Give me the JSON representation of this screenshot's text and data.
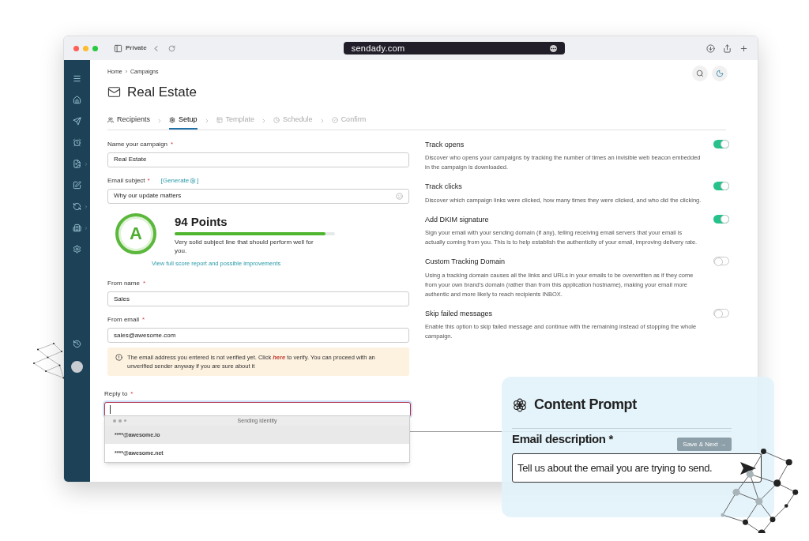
{
  "browser": {
    "private_label": "Private",
    "url": "sendady.com"
  },
  "breadcrumb": [
    "Home",
    "Campaigns"
  ],
  "breadcrumb_separator": "›",
  "title": "Real Estate",
  "steps": [
    {
      "label": "Recipients",
      "selected": false,
      "enabled": true
    },
    {
      "label": "Setup",
      "selected": true,
      "enabled": true
    },
    {
      "label": "Template",
      "selected": false,
      "enabled": false
    },
    {
      "label": "Schedule",
      "selected": false,
      "enabled": false
    },
    {
      "label": "Confirm",
      "selected": false,
      "enabled": false
    }
  ],
  "campaign_name": {
    "label": "Name your campaign",
    "required_mark": "*",
    "value": "Real Estate"
  },
  "subject": {
    "label": "Email subject",
    "required_mark": "*",
    "generate": "[Generate",
    "generate_close": "]",
    "value": "Why our update matters"
  },
  "score": {
    "grade": "A",
    "points": "94 Points",
    "level": 0.94,
    "message": "Very solid subject line that should perform well for you.",
    "report_link": "View full score report and possible improvements"
  },
  "from_name": {
    "label": "From name",
    "required_mark": "*",
    "value": "Sales"
  },
  "from_email": {
    "label": "From email",
    "required_mark": "*",
    "value": "sales@awesome.com"
  },
  "warning": {
    "before": "The email address you entered is not verified yet. Click ",
    "link": "here",
    "after": " to verify. You can proceed with an unverified sender anyway if you are sure about it"
  },
  "reply_to": {
    "label": "Reply to",
    "required_mark": "*",
    "invalid": true,
    "dropdown": {
      "header": "Sending identity",
      "options": [
        {
          "label": "****@awesome.io",
          "selected": true
        },
        {
          "label": "****@awesome.net",
          "selected": false
        }
      ]
    }
  },
  "settings": [
    {
      "title": "Track opens",
      "description": "Discover who opens your campaigns by tracking the number of times an invisible web beacon embedded in the campaign is downloaded.",
      "on": true
    },
    {
      "title": "Track clicks",
      "description": "Discover which campaign links were clicked, how many times they were clicked, and who did the clicking.",
      "on": true
    },
    {
      "title": "Add DKIM signature",
      "description": "Sign your email with your sending domain (if any), telling receiving email servers that your email is actually coming from you. This is to help establish the authenticity of your email, improving delivery rate.",
      "on": true
    },
    {
      "title": "Custom Tracking Domain",
      "description": "Using a tracking domain causes all the links and URLs in your emails to be overwritten as if they come from your own brand's domain (rather than from this application hostname), making your email more authentic and more likely to reach recipients INBOX.",
      "on": false
    },
    {
      "title": "Skip failed messages",
      "description": "Enable this option to skip failed message and continue with the remaining instead of stopping the whole campaign.",
      "on": false
    }
  ],
  "save_button": {
    "label": "Save & Next →",
    "disabled": true
  },
  "prompt_card": {
    "title": "Content Prompt",
    "field_label": "Email description *",
    "placeholder": "Tell us about the email you are trying to send."
  }
}
